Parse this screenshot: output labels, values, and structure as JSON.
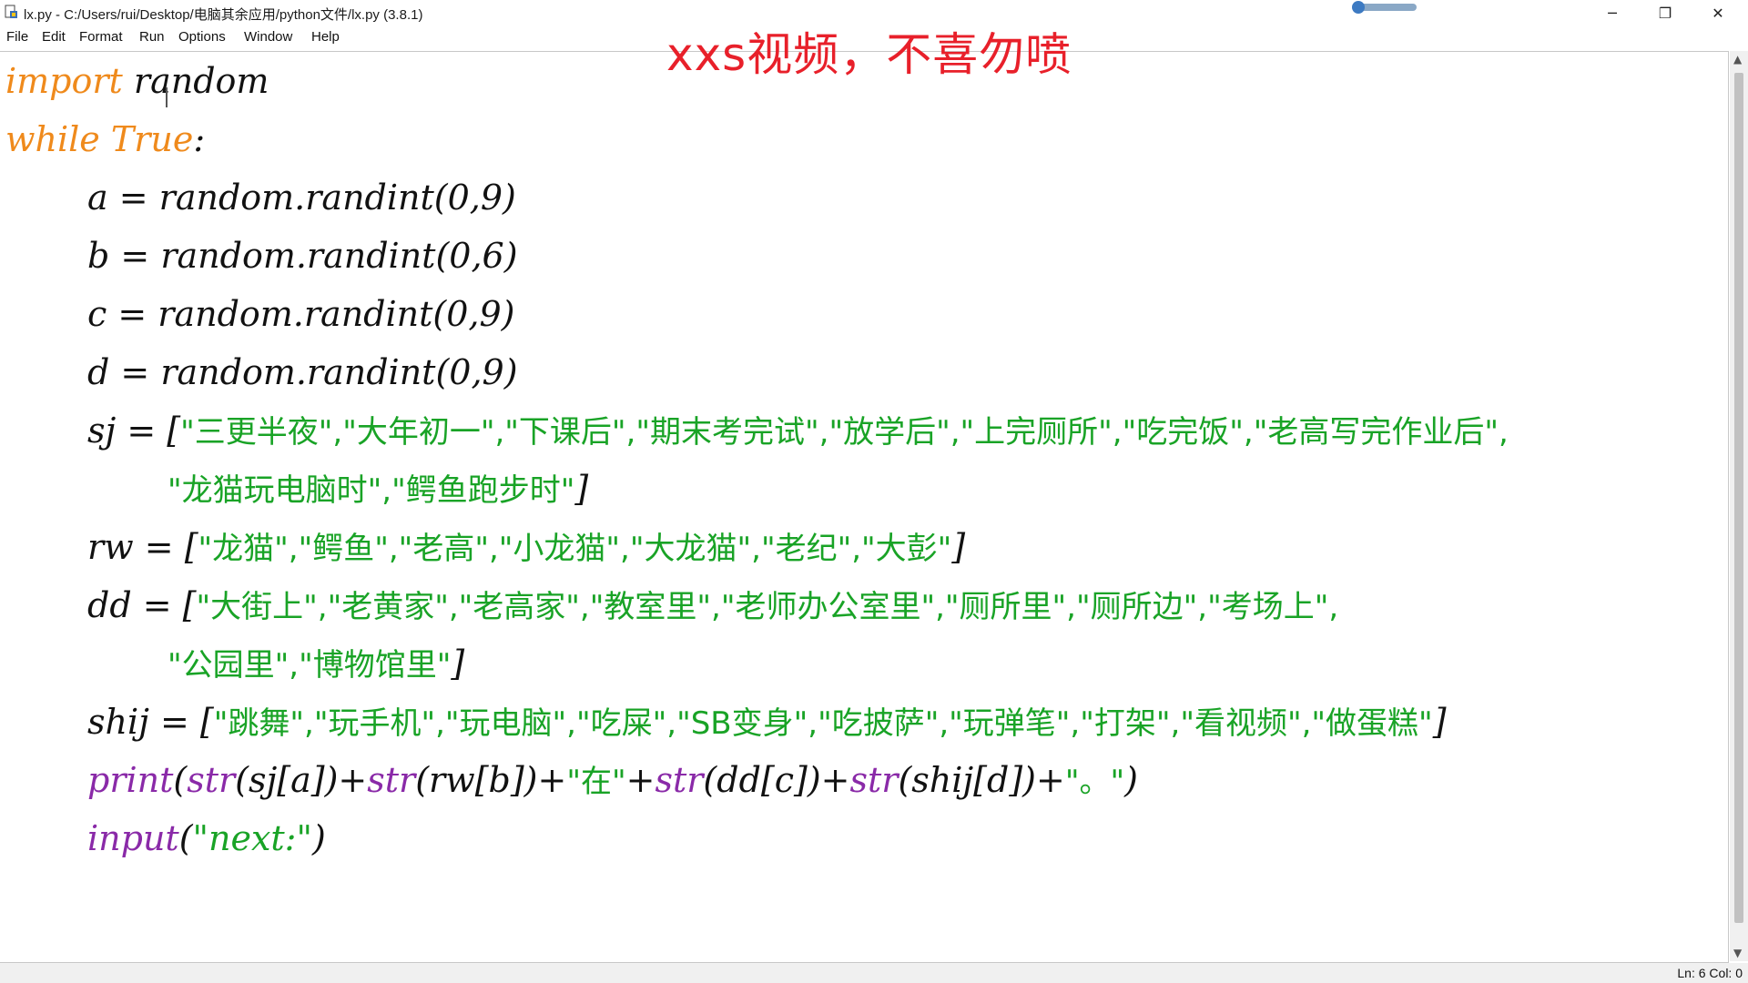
{
  "window": {
    "title": "lx.py - C:/Users/rui/Desktop/电脑其余应用/python文件/lx.py (3.8.1)",
    "minimize_glyph": "─",
    "maximize_glyph": "❐",
    "close_glyph": "✕"
  },
  "menu": [
    "File",
    "Edit",
    "Format",
    "Run",
    "Options",
    "Window",
    "Help"
  ],
  "overlay_caption": "xxs视频，不喜勿喷",
  "status": {
    "position": "Ln: 6   Col: 0"
  },
  "colors": {
    "keyword": "#ef8a1c",
    "builtin": "#8a2aa8",
    "string": "#19a326",
    "overlay": "#e8202a"
  },
  "code": {
    "l1_kw": "import",
    "l1_rest": " random",
    "l2_kw1": "while",
    "l2_kw2": "True",
    "l2_rest": ":",
    "l3": "a = random.randint(0,9)",
    "l4": "b = random.randint(0,6)",
    "l5": "c = random.randint(0,9)",
    "l6": "d = random.randint(0,9)",
    "l7_pre": "sj = [",
    "l7_str": "\"三更半夜\",\"大年初一\",\"下课后\",\"期末考完试\",\"放学后\",\"上完厕所\",\"吃完饭\",\"老高写完作业后\",",
    "l8_str": "\"龙猫玩电脑时\",\"鳄鱼跑步时\"",
    "l8_post": "]",
    "l9_pre": "rw = [",
    "l9_str": "\"龙猫\",\"鳄鱼\",\"老高\",\"小龙猫\",\"大龙猫\",\"老纪\",\"大彭\"",
    "l9_post": "]",
    "l10_pre": "dd = [",
    "l10_str": "\"大街上\",\"老黄家\",\"老高家\",\"教室里\",\"老师办公室里\",\"厕所里\",\"厕所边\",\"考场上\",",
    "l11_str": "\"公园里\",\"博物馆里\"",
    "l11_post": "]",
    "l12_pre": "shij = [",
    "l12_str": "\"跳舞\",\"玩手机\",\"玩电脑\",\"吃屎\",\"SB变身\",\"吃披萨\",\"玩弹笔\",\"打架\",\"看视频\",\"做蛋糕\"",
    "l12_post": "]",
    "l13_print": "print",
    "l13_a": "(",
    "l13_str1": "str",
    "l13_b": "(sj[a])+",
    "l13_str2": "str",
    "l13_c": "(rw[b])+",
    "l13_s1": "\"在\"",
    "l13_d": "+",
    "l13_str3": "str",
    "l13_e": "(dd[c])+",
    "l13_str4": "str",
    "l13_f": "(shij[d])+",
    "l13_s2": "\"。\"",
    "l13_g": ")",
    "l14_input": "input",
    "l14_a": "(",
    "l14_s": "\"next:\"",
    "l14_b": ")"
  }
}
